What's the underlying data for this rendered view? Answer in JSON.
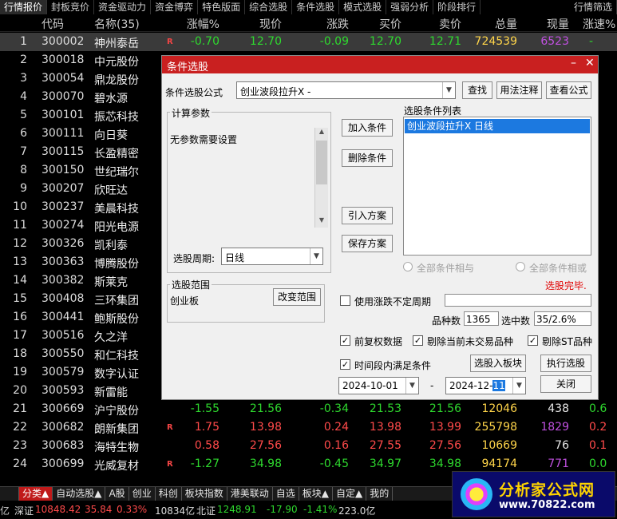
{
  "topnav": [
    "行情报价",
    "封板竞价",
    "资金驱动力",
    "资金博弈",
    "特色版面",
    "综合选股",
    "条件选股",
    "模式选股",
    "强弱分析",
    "阶段排行"
  ],
  "topnav_right": "行情筛选",
  "columns": [
    "代码",
    "名称(35)",
    "涨幅%",
    "现价",
    "涨跌",
    "买价",
    "卖价",
    "总量",
    "现量",
    "涨速%"
  ],
  "rows": [
    {
      "i": "1",
      "code": "300002",
      "name": "神州泰岳",
      "r": "R",
      "pct": "-0.70",
      "price": "12.70",
      "chg": "-0.09",
      "buy": "12.70",
      "sell": "12.71",
      "vol": "724539",
      "now": "6523",
      "spd": "-"
    },
    {
      "i": "2",
      "code": "300018",
      "name": "中元股份"
    },
    {
      "i": "3",
      "code": "300054",
      "name": "鼎龙股份"
    },
    {
      "i": "4",
      "code": "300070",
      "name": "碧水源"
    },
    {
      "i": "5",
      "code": "300101",
      "name": "振芯科技"
    },
    {
      "i": "6",
      "code": "300111",
      "name": "向日葵"
    },
    {
      "i": "7",
      "code": "300115",
      "name": "长盈精密"
    },
    {
      "i": "8",
      "code": "300150",
      "name": "世纪瑞尔"
    },
    {
      "i": "9",
      "code": "300207",
      "name": "欣旺达"
    },
    {
      "i": "10",
      "code": "300237",
      "name": "美晨科技"
    },
    {
      "i": "11",
      "code": "300274",
      "name": "阳光电源"
    },
    {
      "i": "12",
      "code": "300326",
      "name": "凯利泰"
    },
    {
      "i": "13",
      "code": "300363",
      "name": "博腾股份"
    },
    {
      "i": "14",
      "code": "300382",
      "name": "斯莱克"
    },
    {
      "i": "15",
      "code": "300408",
      "name": "三环集团"
    },
    {
      "i": "16",
      "code": "300441",
      "name": "鲍斯股份"
    },
    {
      "i": "17",
      "code": "300516",
      "name": "久之洋"
    },
    {
      "i": "18",
      "code": "300550",
      "name": "和仁科技"
    },
    {
      "i": "19",
      "code": "300579",
      "name": "数字认证"
    },
    {
      "i": "20",
      "code": "300593",
      "name": "新雷能"
    },
    {
      "i": "21",
      "code": "300669",
      "name": "沪宁股份",
      "r": "",
      "pct": "-1.55",
      "price": "21.56",
      "chg": "-0.34",
      "buy": "21.53",
      "sell": "21.56",
      "vol": "12046",
      "now": "438",
      "spd": "0.6"
    },
    {
      "i": "22",
      "code": "300682",
      "name": "朗新集团",
      "r": "R",
      "pct": "1.75",
      "price": "13.98",
      "chg": "0.24",
      "buy": "13.98",
      "sell": "13.99",
      "vol": "255798",
      "now": "1829",
      "spd": "0.2"
    },
    {
      "i": "23",
      "code": "300683",
      "name": "海特生物",
      "r": "",
      "pct": "0.58",
      "price": "27.56",
      "chg": "0.16",
      "buy": "27.55",
      "sell": "27.56",
      "vol": "10669",
      "now": "76",
      "spd": "0.1"
    },
    {
      "i": "24",
      "code": "300699",
      "name": "光威复材",
      "r": "R",
      "pct": "-1.27",
      "price": "34.98",
      "chg": "-0.45",
      "buy": "34.97",
      "sell": "34.98",
      "vol": "94174",
      "now": "771",
      "spd": "0.0"
    }
  ],
  "bottom_tabs": [
    "分类▲",
    "自动选股▲",
    "A股",
    "创业",
    "科创",
    "板块指数",
    "港美联动",
    "自选",
    "板块▲",
    "自定▲",
    "我的"
  ],
  "status": {
    "a": "亿",
    "sz": "深证",
    "sz_val": "10848.42",
    "sz_chg": "35.84",
    "sz_pct": "0.33%",
    "amt": "10834亿",
    "bz": "北证",
    "bz_val": "1248.91",
    "bz_chg": "-17.90",
    "bz_pct": "-1.41%",
    "bz_amt": "223.0亿"
  },
  "logo": {
    "text": "分析家公式网",
    "url": "www.70822.com"
  },
  "dialog": {
    "title": "条件选股",
    "formula_label": "条件选股公式",
    "formula_value": "创业波段拉升X  -",
    "btn_find": "查找",
    "btn_usage": "用法注释",
    "btn_view": "查看公式",
    "calc_params": "计算参数",
    "no_params": "无参数需要设置",
    "period_label": "选股周期:",
    "period_value": "日线",
    "btn_add": "加入条件",
    "btn_del": "删除条件",
    "btn_import": "引入方案",
    "btn_save": "保存方案",
    "list_title": "选股条件列表",
    "list_item": "创业波段拉升X  日线",
    "radio_and": "全部条件相与",
    "radio_or": "全部条件相或",
    "done": "选股完毕.",
    "range_title": "选股范围",
    "range_value": "创业板",
    "btn_change": "改变范围",
    "use_period": "使用涨跌不定周期",
    "count_label": "品种数",
    "count_value": "1365",
    "hit_label": "选中数",
    "hit_value": "35/2.6%",
    "fq": "前复权数据",
    "exclude_no_trade": "剔除当前未交易品种",
    "exclude_st": "剔除ST品种",
    "time_cond": "时间段内满足条件",
    "btn_to_block": "选股入板块",
    "btn_run": "执行选股",
    "date_from": "2024-10-01",
    "date_to_prefix": "2024-12-",
    "date_to_sel": "11",
    "dash": "-",
    "btn_close": "关闭"
  }
}
